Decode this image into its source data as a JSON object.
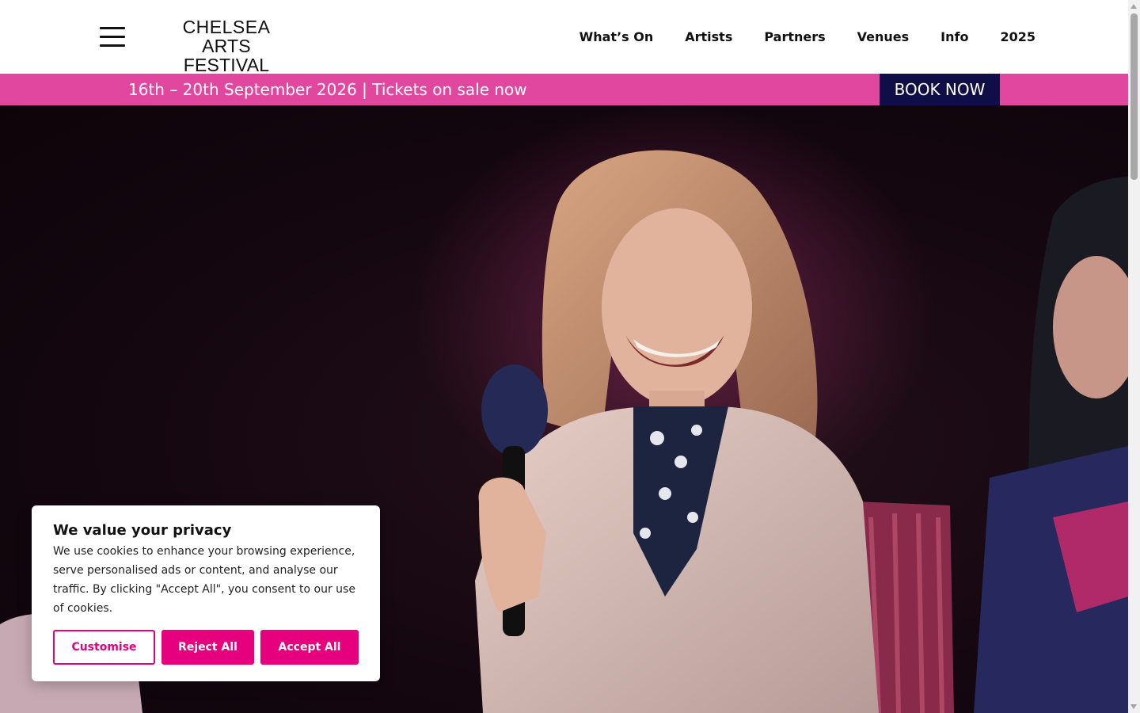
{
  "header": {
    "logo_line1": "CHELSEA",
    "logo_line2": "ARTS FESTIVAL",
    "nav": [
      "What’s On",
      "Artists",
      "Partners",
      "Venues",
      "Info",
      "2025"
    ]
  },
  "banner": {
    "text": "16th – 20th September 2026 | Tickets on sale now",
    "book_label": "BOOK NOW"
  },
  "cookie": {
    "title": "We value your privacy",
    "body": "We use cookies to enhance your browsing experience, serve personalised ads or content, and analyse our traffic. By clicking \"Accept All\", you consent to our use of cookies.",
    "customise_label": "Customise",
    "reject_label": "Reject All",
    "accept_label": "Accept All"
  },
  "colors": {
    "banner_pink": "#e2479f",
    "book_navy": "#0f0e46",
    "cookie_accent": "#e6007e"
  }
}
